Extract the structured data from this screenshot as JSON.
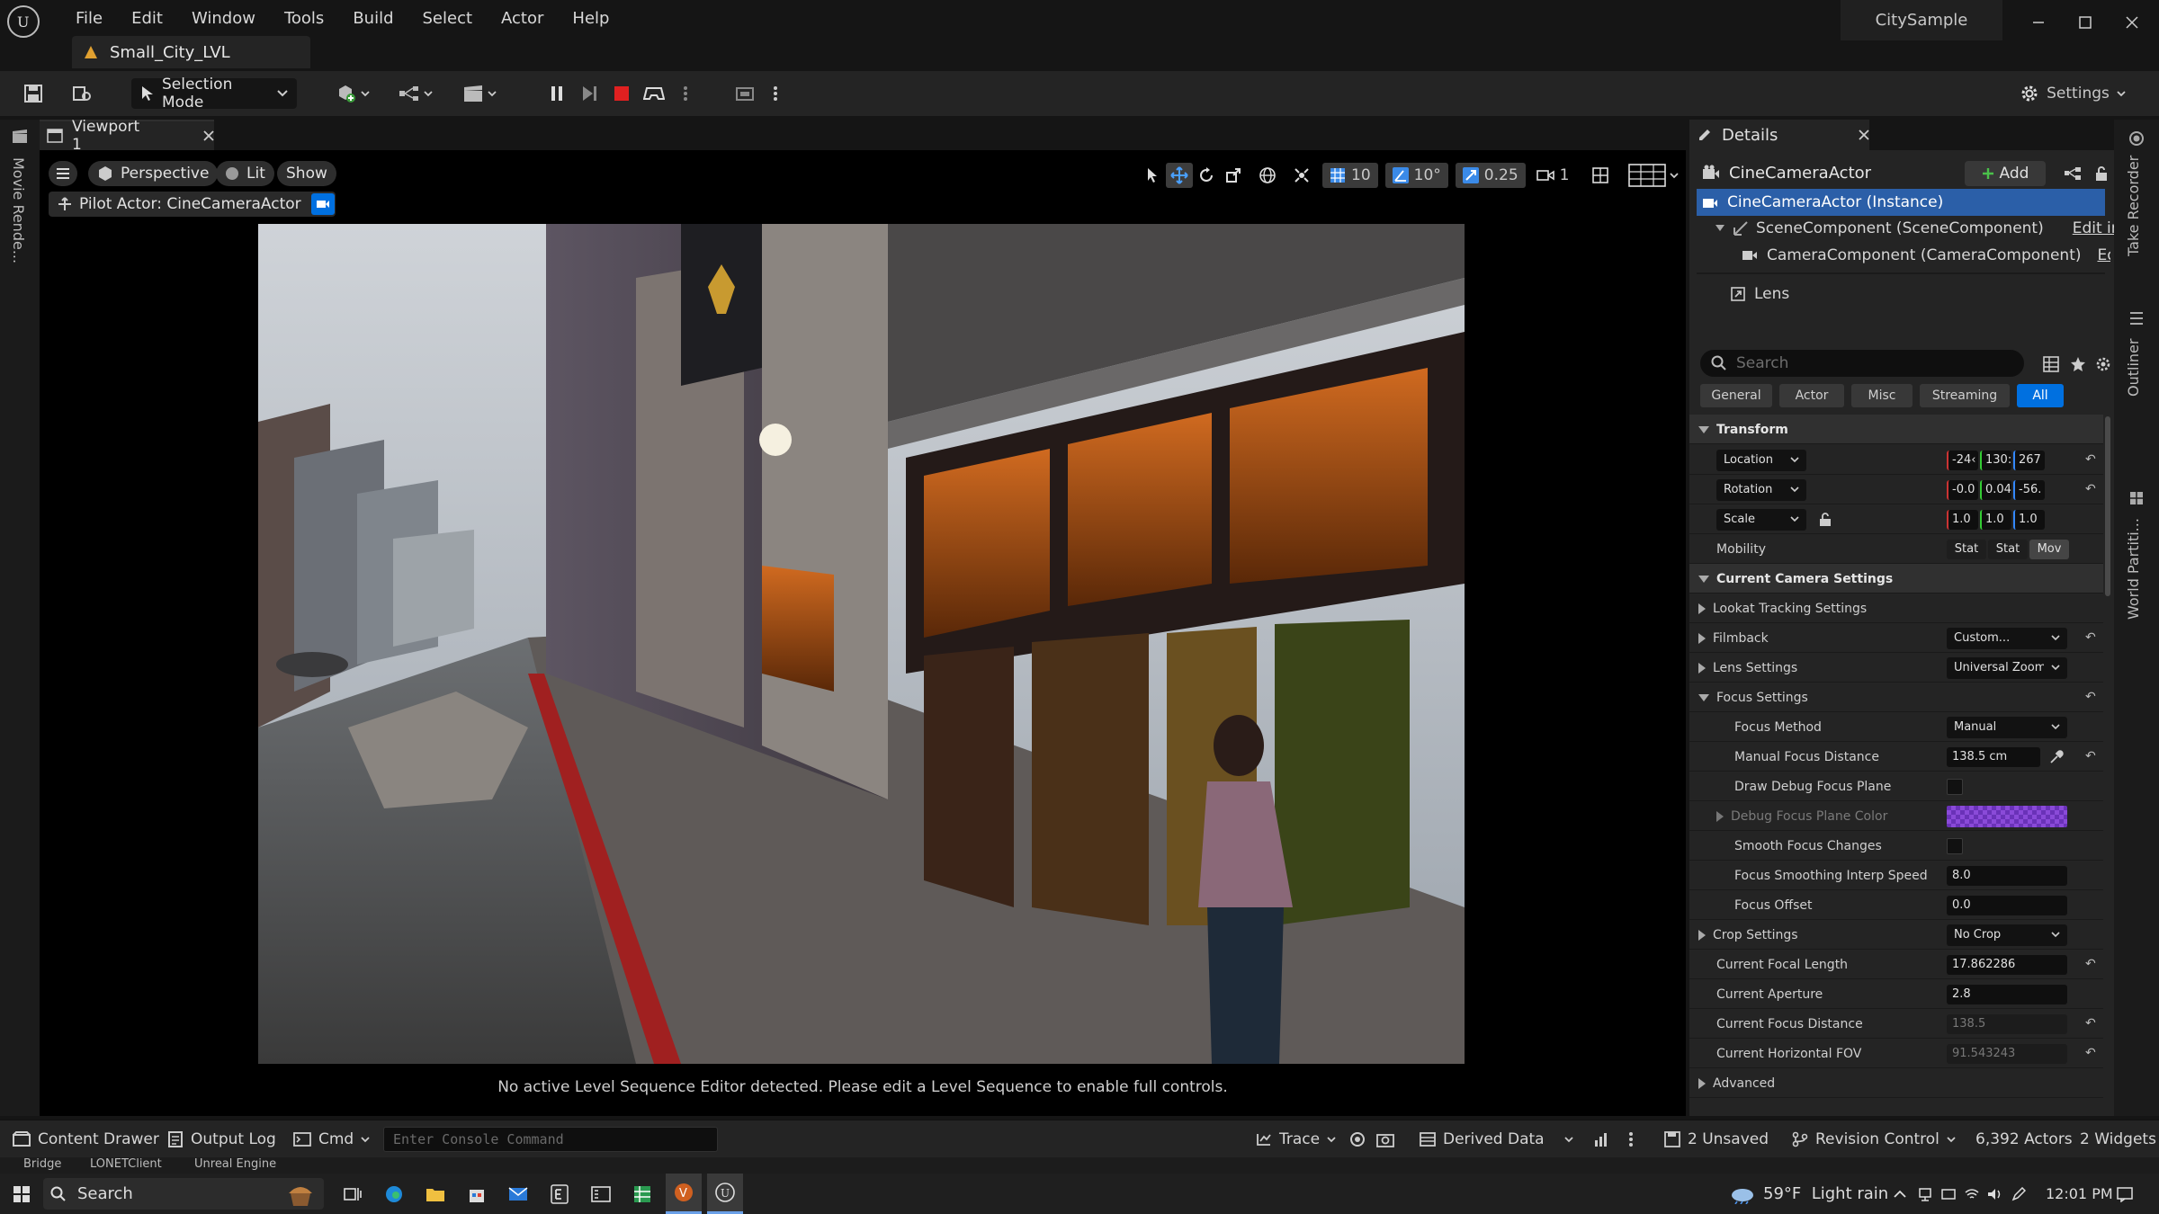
{
  "app": {
    "menus": [
      "File",
      "Edit",
      "Window",
      "Tools",
      "Build",
      "Select",
      "Actor",
      "Help"
    ],
    "level_tab": "Small_City_LVL",
    "project_name": "CitySample"
  },
  "toolbar": {
    "selection_mode": "Selection Mode",
    "settings": "Settings"
  },
  "left_strip": {
    "label": "Movie Rende..."
  },
  "viewport": {
    "tab_label": "Viewport 1",
    "perspective": "Perspective",
    "lit": "Lit",
    "show": "Show",
    "pilot_label": "Pilot Actor: CineCameraActor",
    "grid_snap": "10",
    "rot_snap": "10°",
    "scale_snap": "0.25",
    "cam_speed": "1",
    "status_message": "No active Level Sequence Editor detected. Please edit a Level Sequence to enable full controls."
  },
  "details": {
    "tab_label": "Details",
    "actor_name": "CineCameraActor",
    "add_label": "Add",
    "components": [
      {
        "label": "CineCameraActor (Instance)",
        "link": ""
      },
      {
        "label": "SceneComponent (SceneComponent)",
        "link": "Edit in C++"
      },
      {
        "label": "CameraComponent (CameraComponent)",
        "link": "Edit in C"
      }
    ],
    "lens_label": "Lens",
    "search_placeholder": "Search",
    "filters": [
      "General",
      "Actor",
      "Misc",
      "Streaming",
      "All"
    ],
    "transform": {
      "header": "Transform",
      "location": {
        "label": "Location",
        "x": "-24‹",
        "y": "130:",
        "z": "267"
      },
      "rotation": {
        "label": "Rotation",
        "x": "-0.0",
        "y": "0.04",
        "z": "-56."
      },
      "scale": {
        "label": "Scale",
        "x": "1.0",
        "y": "1.0",
        "z": "1.0"
      },
      "mobility": {
        "label": "Mobility",
        "options": [
          "Stat",
          "Stat",
          "Mov"
        ]
      }
    },
    "camera_settings": {
      "header": "Current Camera Settings",
      "lookat": "Lookat Tracking Settings",
      "filmback": {
        "label": "Filmback",
        "value": "Custom..."
      },
      "lens_settings": {
        "label": "Lens Settings",
        "value": "Universal Zoom"
      },
      "focus_settings": "Focus Settings",
      "focus_method": {
        "label": "Focus Method",
        "value": "Manual"
      },
      "manual_focus": {
        "label": "Manual Focus Distance",
        "value": "138.5 cm"
      },
      "draw_debug": "Draw Debug Focus Plane",
      "debug_color": "Debug Focus Plane Color",
      "smooth_focus": "Smooth Focus Changes",
      "smoothing_speed": {
        "label": "Focus Smoothing Interp Speed",
        "value": "8.0"
      },
      "focus_offset": {
        "label": "Focus Offset",
        "value": "0.0"
      },
      "crop": {
        "label": "Crop Settings",
        "value": "No Crop"
      },
      "focal_length": {
        "label": "Current Focal Length",
        "value": "17.862286"
      },
      "aperture": {
        "label": "Current Aperture",
        "value": "2.8"
      },
      "focus_distance": {
        "label": "Current Focus Distance",
        "value": "138.5"
      },
      "hfov": {
        "label": "Current Horizontal FOV",
        "value": "91.543243"
      },
      "advanced": "Advanced"
    }
  },
  "right_strip": {
    "take_recorder": "Take Recorder",
    "outliner": "Outliner",
    "world_partition": "World Partiti..."
  },
  "bottom": {
    "content_drawer": "Content Drawer",
    "output_log": "Output Log",
    "cmd": "Cmd",
    "console_placeholder": "Enter Console Command",
    "trace": "Trace",
    "derived_data": "Derived Data",
    "unsaved": "2 Unsaved",
    "revision": "Revision Control",
    "actors": "6,392 Actors",
    "widgets": "2 Widgets"
  },
  "behind_labels": [
    "Bridge",
    "LONETClient",
    "Unreal Engine"
  ],
  "taskbar": {
    "search": "Search",
    "weather": "59°F  Light rain",
    "time": "12:01 PM"
  },
  "colors": {
    "accent": "#0070e0",
    "selected_row": "#2b5fa8",
    "debug_plane": "#7b3fd0"
  }
}
